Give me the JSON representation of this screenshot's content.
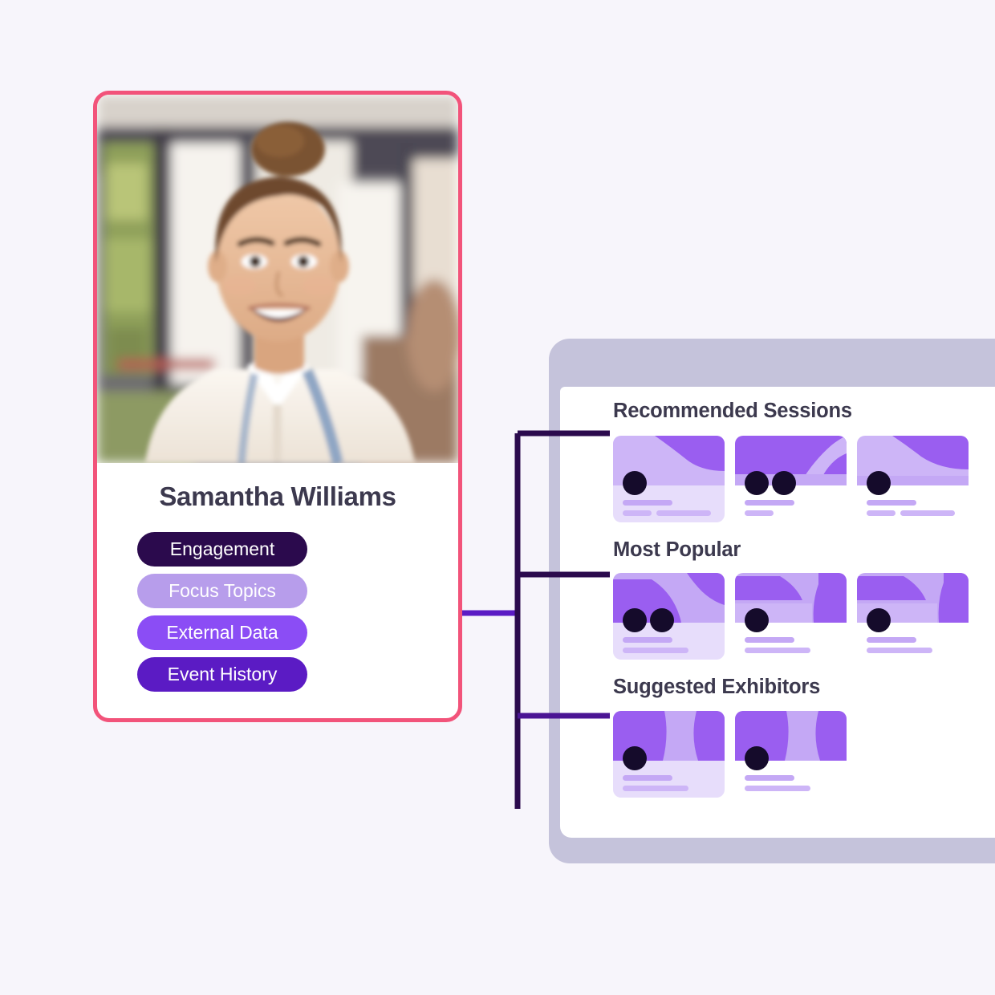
{
  "theme": {
    "page_background": "#f7f5fb",
    "card_border": "#f2537a",
    "panel_frame": "#c5c3db",
    "connector_dark": "#2b0a4d",
    "connector_light": "#9a7de8",
    "connector_mid": "#7b3ff2",
    "connector_deep": "#5b1bc4",
    "heading_text": "#3c394e"
  },
  "profile": {
    "photo_alt": "smiling-woman-with-lanyard-portrait",
    "name": "Samantha Williams",
    "pills": [
      {
        "label": "Engagement",
        "color": "#2b0a4d",
        "text_color": "#ffffff"
      },
      {
        "label": "Focus Topics",
        "color": "#b79deb",
        "text_color": "#ffffff"
      },
      {
        "label": "External Data",
        "color": "#8b4df5",
        "text_color": "#ffffff"
      },
      {
        "label": "Event History",
        "color": "#5b1bc4",
        "text_color": "#ffffff"
      }
    ]
  },
  "panel": {
    "sections": [
      {
        "title": "Recommended Sessions",
        "cards": [
          {
            "name": "session-card-1",
            "body": "lavender",
            "avatars": 1,
            "bars": "three",
            "art": "blob-top-right"
          },
          {
            "name": "session-card-2",
            "body": "white",
            "avatars": 2,
            "bars": "two",
            "art": "blob-right-arc"
          },
          {
            "name": "session-card-3",
            "body": "white",
            "avatars": 1,
            "bars": "three",
            "art": "blob-top-right"
          }
        ]
      },
      {
        "title": "Most Popular",
        "cards": [
          {
            "name": "popular-card-1",
            "body": "lavender",
            "avatars": 2,
            "bars": "two",
            "art": "blob-left-arc"
          },
          {
            "name": "popular-card-2",
            "body": "white",
            "avatars": 1,
            "bars": "two",
            "art": "blob-left-arc"
          },
          {
            "name": "popular-card-3",
            "body": "white",
            "avatars": 1,
            "bars": "two",
            "art": "blob-left-arc"
          }
        ]
      },
      {
        "title": "Suggested Exhibitors",
        "cards": [
          {
            "name": "exhibitor-card-1",
            "body": "lavender",
            "avatars": 1,
            "bars": "two",
            "art": "blob-columns"
          },
          {
            "name": "exhibitor-card-2",
            "body": "white",
            "avatars": 1,
            "bars": "two",
            "art": "blob-columns"
          }
        ]
      }
    ]
  }
}
